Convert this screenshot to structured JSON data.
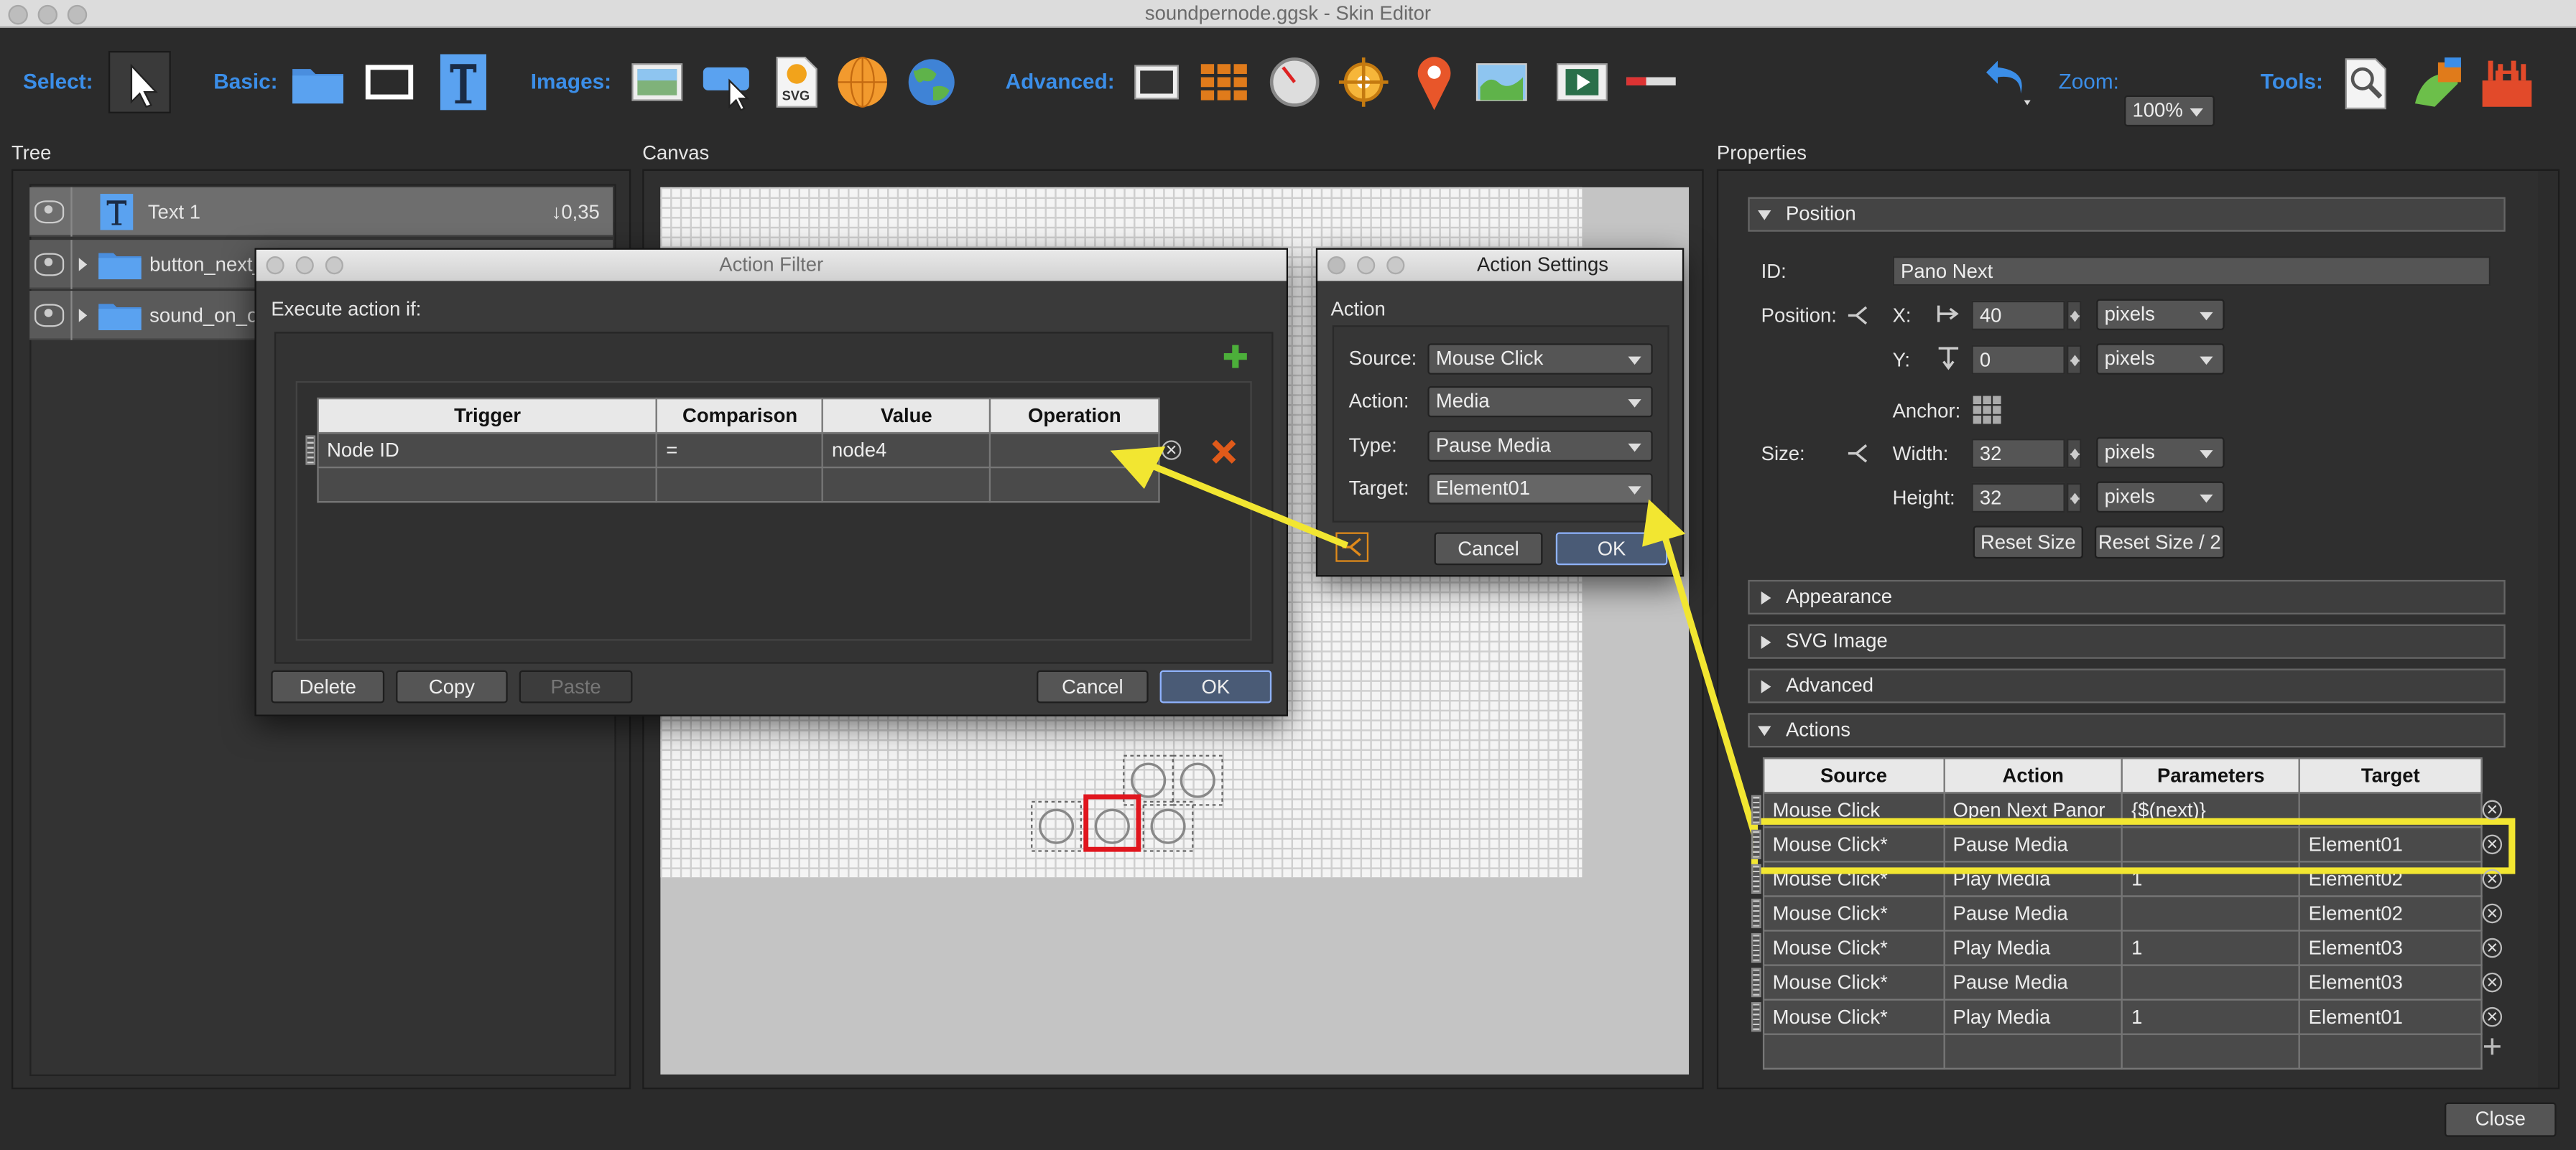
{
  "window": {
    "title": "soundpernode.ggsk - Skin Editor"
  },
  "toolbar": {
    "select_label": "Select:",
    "basic_label": "Basic:",
    "images_label": "Images:",
    "advanced_label": "Advanced:",
    "zoom_label": "Zoom:",
    "zoom_value": "100%",
    "tools_label": "Tools:"
  },
  "sections": {
    "tree": "Tree",
    "canvas": "Canvas",
    "properties": "Properties"
  },
  "tree": {
    "items": [
      {
        "label": "Text 1",
        "value": "↓0,35"
      },
      {
        "label": "button_next_"
      },
      {
        "label": "sound_on_off"
      }
    ]
  },
  "action_filter": {
    "title": "Action Filter",
    "execute_label": "Execute action if:",
    "columns": [
      "Trigger",
      "Comparison",
      "Value",
      "Operation"
    ],
    "rows": [
      {
        "trigger": "Node ID",
        "comparison": "=",
        "value": "node4",
        "operation": ""
      }
    ],
    "delete": "Delete",
    "copy": "Copy",
    "paste": "Paste",
    "cancel": "Cancel",
    "ok": "OK"
  },
  "action_settings": {
    "title": "Action Settings",
    "group": "Action",
    "source_label": "Source:",
    "source": "Mouse Click",
    "action_label": "Action:",
    "action": "Media",
    "type_label": "Type:",
    "type": "Pause Media",
    "target_label": "Target:",
    "target": "Element01",
    "cancel": "Cancel",
    "ok": "OK"
  },
  "properties": {
    "position_header": "Position",
    "id_label": "ID:",
    "id": "Pano Next",
    "position_label": "Position:",
    "x_label": "X:",
    "x": "40",
    "y_label": "Y:",
    "y": "0",
    "unit": "pixels",
    "anchor_label": "Anchor:",
    "size_label": "Size:",
    "width_label": "Width:",
    "width": "32",
    "height_label": "Height:",
    "height": "32",
    "reset_size": "Reset Size",
    "reset_size_half": "Reset Size / 2",
    "appearance": "Appearance",
    "svg_image": "SVG Image",
    "advanced": "Advanced",
    "actions": "Actions",
    "actions_columns": [
      "Source",
      "Action",
      "Parameters",
      "Target"
    ],
    "actions_rows": [
      {
        "source": "Mouse Click",
        "action": "Open Next Panor",
        "params": "{$(next)}",
        "target": ""
      },
      {
        "source": "Mouse Click*",
        "action": "Pause Media",
        "params": "",
        "target": "Element01"
      },
      {
        "source": "Mouse Click*",
        "action": "Play Media",
        "params": "1",
        "target": "Element02"
      },
      {
        "source": "Mouse Click*",
        "action": "Pause Media",
        "params": "",
        "target": "Element02"
      },
      {
        "source": "Mouse Click*",
        "action": "Play Media",
        "params": "1",
        "target": "Element03"
      },
      {
        "source": "Mouse Click*",
        "action": "Pause Media",
        "params": "",
        "target": "Element03"
      },
      {
        "source": "Mouse Click*",
        "action": "Play Media",
        "params": "1",
        "target": "Element01"
      }
    ]
  },
  "footer": {
    "close": "Close"
  },
  "colors": {
    "accent_blue": "#3b8ee8",
    "annotation_yellow": "#f2e631",
    "selection_red": "#e0161e",
    "add_green": "#4caf3a",
    "delete_orange": "#e05a1a"
  }
}
